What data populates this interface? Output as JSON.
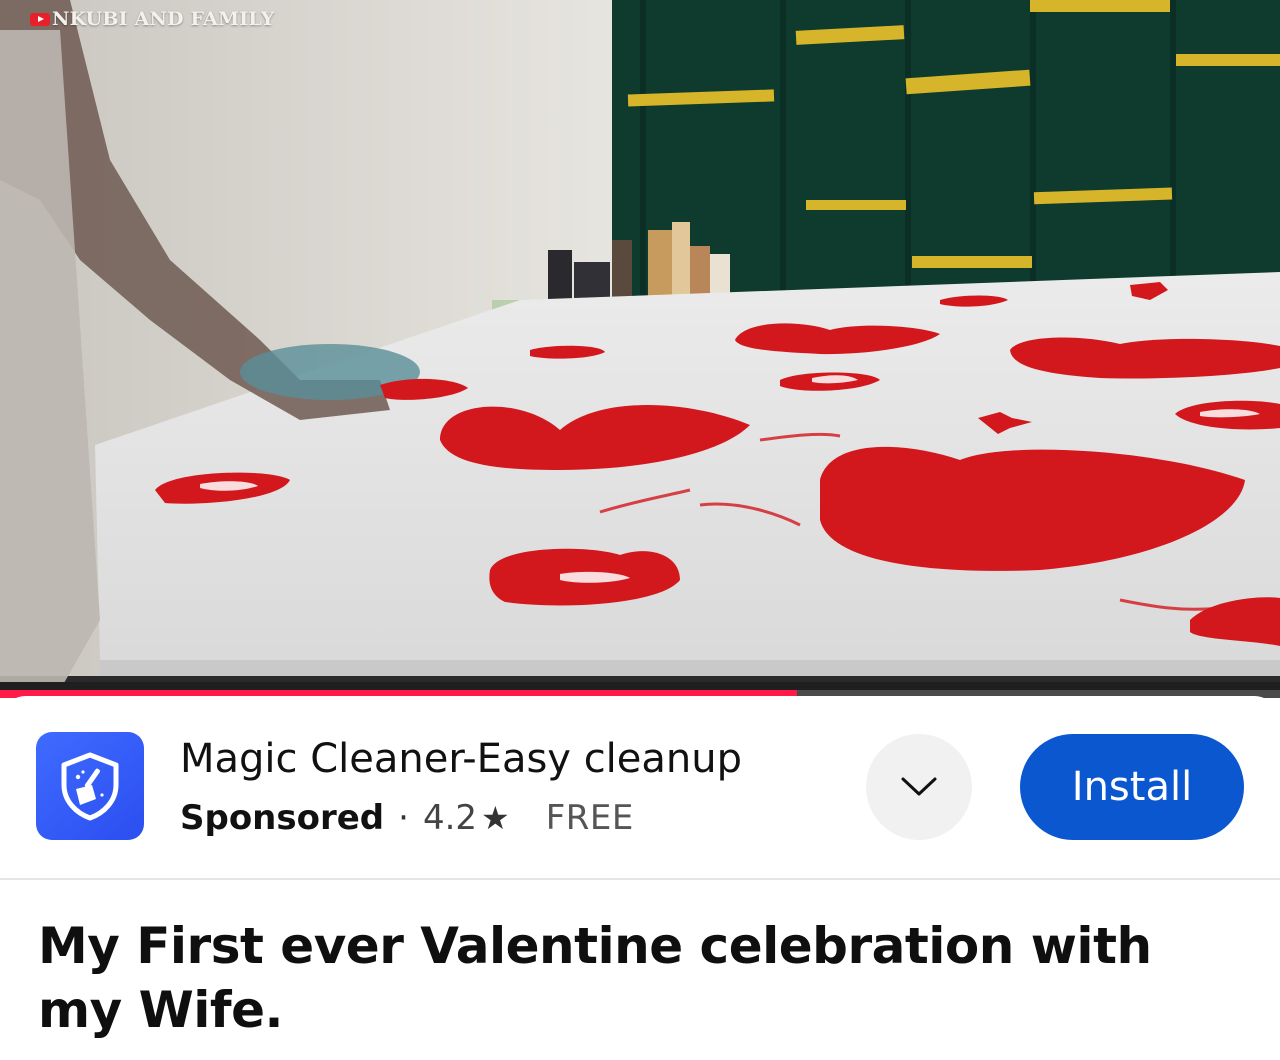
{
  "video": {
    "watermark_text": "NKUBI AND FAMILY",
    "progress_fraction": 0.623
  },
  "ad": {
    "app_name": "Magic Cleaner-Easy cleanup",
    "sponsored_label": "Sponsored",
    "separator": "·",
    "rating": "4.2",
    "rating_star": "★",
    "price": "FREE",
    "install_label": "Install",
    "icon": "shield-broom-icon",
    "accent_color": "#0b57d0"
  },
  "video_title": "My First ever Valentine celebration with my Wife."
}
